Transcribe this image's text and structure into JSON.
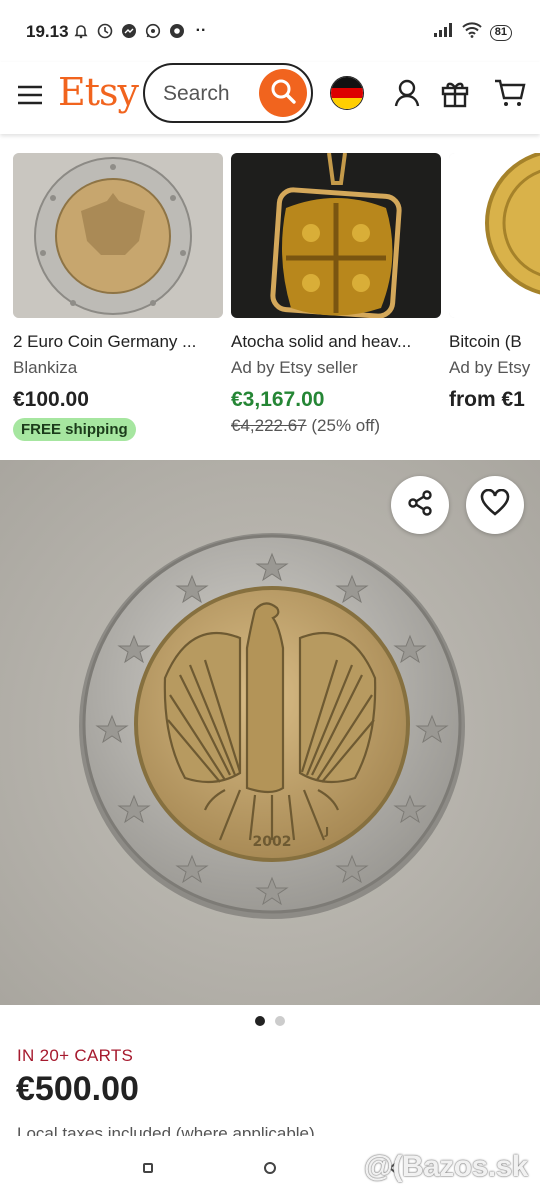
{
  "status_bar": {
    "time": "19.13",
    "battery": "81"
  },
  "header": {
    "logo": "Etsy",
    "search_placeholder": "Search"
  },
  "recommendations": [
    {
      "title": "2 Euro Coin Germany ...",
      "seller": "Blankiza",
      "price": "€100.00",
      "badge": "FREE shipping"
    },
    {
      "title": "Atocha solid and heav...",
      "seller": "Ad by Etsy seller",
      "price": "€3,167.00",
      "original_price": "€4,222.67",
      "discount": "(25% off)"
    },
    {
      "title": "Bitcoin (B",
      "seller": "Ad by Etsy",
      "price": "from €1"
    }
  ],
  "listing": {
    "image_count": 2,
    "active_image": 1,
    "carts_label": "IN 20+ CARTS",
    "price": "€500.00",
    "taxes_note": "Local taxes included (where applicable)"
  },
  "coin": {
    "year": "2002",
    "mint_mark": "J"
  },
  "watermark": "@(Bazos.sk",
  "colors": {
    "brand": "#F1641E",
    "sale_green": "#258635",
    "free_shipping_bg": "#A6E6A0",
    "carts_red": "#A61A2E"
  }
}
